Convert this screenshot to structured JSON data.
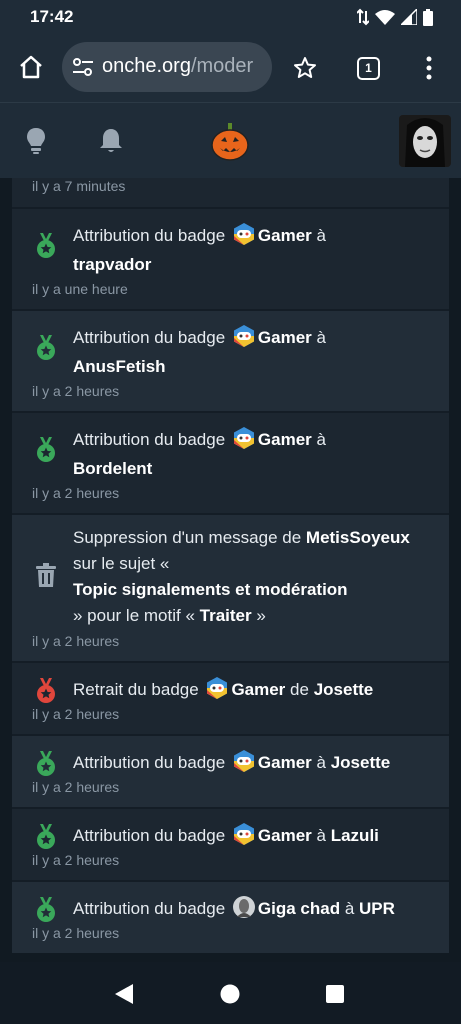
{
  "status": {
    "time": "17:42"
  },
  "browser": {
    "url_host": "onche.org",
    "url_path": "/moder",
    "tab_count": "1"
  },
  "feed": {
    "top_time": "il y a 7 minutes",
    "items": [
      {
        "type": "award",
        "pre": "Attribution du badge",
        "badge": "Gamer",
        "mid": "à",
        "user": "trapvador",
        "time": "il y a une heure"
      },
      {
        "type": "award",
        "pre": "Attribution du badge",
        "badge": "Gamer",
        "mid": "à",
        "user": "AnusFetish",
        "time": "il y a 2 heures"
      },
      {
        "type": "award",
        "pre": "Attribution du badge",
        "badge": "Gamer",
        "mid": "à",
        "user": "Bordelent",
        "time": "il y a 2 heures"
      },
      {
        "type": "delete",
        "pre": "Suppression d'un message de",
        "user": "MetisSoyeux",
        "mid1": "sur le sujet «",
        "topic": "Topic signalements et modération",
        "mid2": "» pour le motif «",
        "reason": "Traiter",
        "end": "»",
        "time": "il y a 2 heures"
      },
      {
        "type": "remove",
        "pre": "Retrait du badge",
        "badge": "Gamer",
        "mid": "de",
        "user": "Josette",
        "time": "il y a 2 heures"
      },
      {
        "type": "award",
        "pre": "Attribution du badge",
        "badge": "Gamer",
        "mid": "à",
        "user": "Josette",
        "time": "il y a 2 heures"
      },
      {
        "type": "award",
        "pre": "Attribution du badge",
        "badge": "Gamer",
        "mid": "à",
        "user": "Lazuli",
        "time": "il y a 2 heures"
      },
      {
        "type": "award",
        "pre": "Attribution du badge",
        "badge": "Giga chad",
        "mid": "à",
        "user": "UPR",
        "time": "il y a 2 heures"
      }
    ]
  },
  "colors": {
    "award": "#3aa85a",
    "remove": "#e0463c",
    "trash": "#9aa6b2"
  },
  "icons": [
    "home-icon",
    "site-settings-icon",
    "star-icon",
    "tab-switcher-icon",
    "more-vert-icon",
    "lightbulb-icon",
    "bell-icon",
    "pumpkin-logo",
    "back-icon",
    "home-circle-icon",
    "recents-icon"
  ]
}
